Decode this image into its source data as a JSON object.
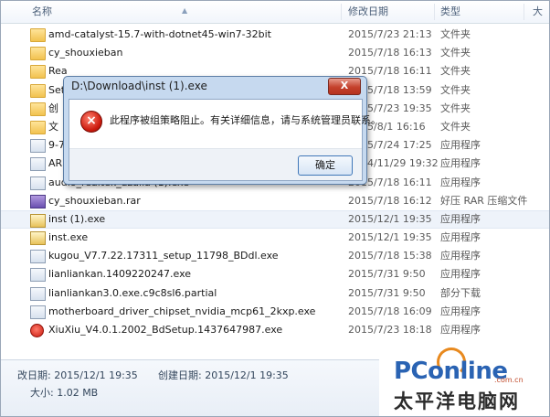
{
  "columns": {
    "name": "名称",
    "date": "修改日期",
    "type": "类型",
    "size": "大"
  },
  "files": [
    {
      "icon": "folder-icon",
      "name": "amd-catalyst-15.7-with-dotnet45-win7-32bit",
      "date": "2015/7/23 21:13",
      "type": "文件夹"
    },
    {
      "icon": "folder-icon",
      "name": "cy_shouxieban",
      "date": "2015/7/18 16:13",
      "type": "文件夹"
    },
    {
      "icon": "folder-icon",
      "name": "Rea",
      "date": "2015/7/18 16:11",
      "type": "文件夹"
    },
    {
      "icon": "folder-icon",
      "name": "Set",
      "date": "2015/7/18 13:59",
      "type": "文件夹"
    },
    {
      "icon": "folder-icon",
      "name": "创",
      "date": "2015/7/23 19:35",
      "type": "文件夹"
    },
    {
      "icon": "folder-icon",
      "name": "文",
      "date": "2015/8/1 16:16",
      "type": "文件夹"
    },
    {
      "icon": "exe-icon",
      "name": "9-7",
      "date": "2015/7/24 17:25",
      "type": "应用程序"
    },
    {
      "icon": "exe-icon",
      "name": "AR",
      "date": "2014/11/29 19:32",
      "type": "应用程序"
    },
    {
      "icon": "exe-icon",
      "name": "audio_realtek_azalia (1).exe",
      "date": "2015/7/18 16:11",
      "type": "应用程序"
    },
    {
      "icon": "rar-icon",
      "name": "cy_shouxieban.rar",
      "date": "2015/7/18 16:12",
      "type": "好压 RAR 压缩文件"
    },
    {
      "icon": "pkg-icon",
      "name": "inst (1).exe",
      "date": "2015/12/1 19:35",
      "type": "应用程序",
      "selected": true
    },
    {
      "icon": "pkg-icon",
      "name": "inst.exe",
      "date": "2015/12/1 19:35",
      "type": "应用程序"
    },
    {
      "icon": "exe-icon",
      "name": "kugou_V7.7.22.17311_setup_11798_BDdl.exe",
      "date": "2015/7/18 15:38",
      "type": "应用程序"
    },
    {
      "icon": "exe-icon",
      "name": "lianliankan.1409220247.exe",
      "date": "2015/7/31 9:50",
      "type": "应用程序"
    },
    {
      "icon": "exe-icon",
      "name": "lianliankan3.0.exe.c9c8sl6.partial",
      "date": "2015/7/31 9:50",
      "type": "部分下载"
    },
    {
      "icon": "exe-icon",
      "name": "motherboard_driver_chipset_nvidia_mcp61_2kxp.exe",
      "date": "2015/7/18 16:09",
      "type": "应用程序"
    },
    {
      "icon": "red-icon",
      "name": "XiuXiu_V4.0.1.2002_BdSetup.1437647987.exe",
      "date": "2015/7/23 18:18",
      "type": "应用程序"
    }
  ],
  "status": {
    "modified": "改日期: 2015/12/1 19:35",
    "created": "创建日期: 2015/12/1 19:35",
    "size": "大小: 1.02 MB"
  },
  "dialog": {
    "title": "D:\\Download\\inst (1).exe",
    "close": "X",
    "message": "此程序被组策略阻止。有关详细信息，请与系统管理员联系。",
    "ok": "确定"
  },
  "watermark": {
    "en": "PConline",
    "com": ".com.cn",
    "cn": "太平洋电脑网"
  }
}
